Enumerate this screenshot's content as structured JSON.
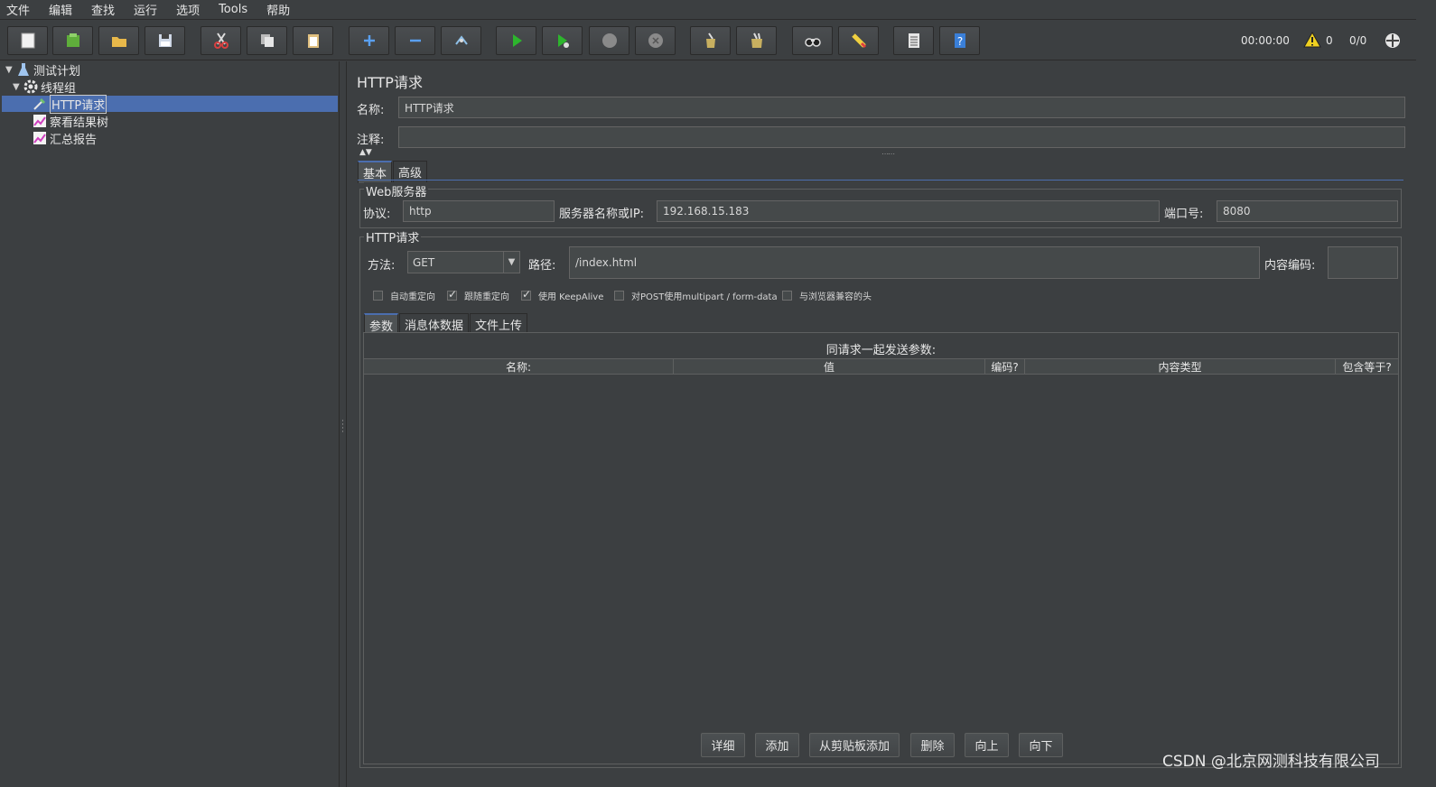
{
  "menu": [
    "文件",
    "编辑",
    "查找",
    "运行",
    "选项",
    "Tools",
    "帮助"
  ],
  "toolbar": {
    "buttons": [
      {
        "name": "new-icon",
        "color": "#f2f2f2"
      },
      {
        "name": "templates-icon",
        "color": "#5fae3b"
      },
      {
        "name": "open-icon",
        "color": "#e8b84a"
      },
      {
        "name": "save-icon",
        "color": "#cfd8e6"
      },
      {
        "name": "cut-icon",
        "color": "#d94040"
      },
      {
        "name": "copy-icon",
        "color": "#dcdcdc"
      },
      {
        "name": "paste-icon",
        "color": "#e0c080"
      },
      {
        "name": "expand-icon",
        "color": "#5aa0f0"
      },
      {
        "name": "collapse-icon",
        "color": "#5aa0f0"
      },
      {
        "name": "toggle-icon",
        "color": "#8fc0e8"
      },
      {
        "name": "start-icon",
        "color": "#2db52d"
      },
      {
        "name": "start-no-pause-icon",
        "color": "#2db52d"
      },
      {
        "name": "stop-icon",
        "color": "#8a8a8a"
      },
      {
        "name": "shutdown-icon",
        "color": "#8a8a8a"
      },
      {
        "name": "clear-icon",
        "color": "#c8b060"
      },
      {
        "name": "clear-all-icon",
        "color": "#c8b060"
      },
      {
        "name": "search-icon",
        "color": "#dddddd"
      },
      {
        "name": "reset-search-icon",
        "color": "#f0d040"
      },
      {
        "name": "function-helper-icon",
        "color": "#e6e6e6"
      },
      {
        "name": "help-icon",
        "color": "#3a7fd8"
      }
    ],
    "timer": "00:00:00",
    "warning_count": "0",
    "thread_count": "0/0"
  },
  "tree": {
    "items": [
      {
        "label": "测试计划"
      },
      {
        "label": "线程组"
      },
      {
        "label": "HTTP请求"
      },
      {
        "label": "察看结果树"
      },
      {
        "label": "汇总报告"
      }
    ]
  },
  "panel": {
    "title": "HTTP请求",
    "name_label": "名称:",
    "name_value": "HTTP请求",
    "comment_label": "注释:",
    "comment_value": "",
    "tabs": [
      "基本",
      "高级"
    ],
    "web_server": {
      "title": "Web服务器",
      "protocol_label": "协议:",
      "protocol_value": "http",
      "server_label": "服务器名称或IP:",
      "server_value": "192.168.15.183",
      "port_label": "端口号:",
      "port_value": "8080"
    },
    "http_request": {
      "title": "HTTP请求",
      "method_label": "方法:",
      "method_value": "GET",
      "path_label": "路径:",
      "path_value": "/index.html",
      "encoding_label": "内容编码:",
      "encoding_value": ""
    },
    "checkboxes": [
      {
        "label": "自动重定向",
        "checked": false
      },
      {
        "label": "跟随重定向",
        "checked": true
      },
      {
        "label": "使用 KeepAlive",
        "checked": true
      },
      {
        "label": "对POST使用multipart / form-data",
        "checked": false
      },
      {
        "label": "与浏览器兼容的头",
        "checked": false
      }
    ],
    "sub_tabs": [
      "参数",
      "消息体数据",
      "文件上传"
    ],
    "params_caption": "同请求一起发送参数:",
    "columns": [
      "名称:",
      "值",
      "编码?",
      "内容类型",
      "包含等于?"
    ],
    "buttons": [
      "详细",
      "添加",
      "从剪贴板添加",
      "删除",
      "向上",
      "向下"
    ]
  },
  "watermark": "CSDN @北京网测科技有限公司"
}
